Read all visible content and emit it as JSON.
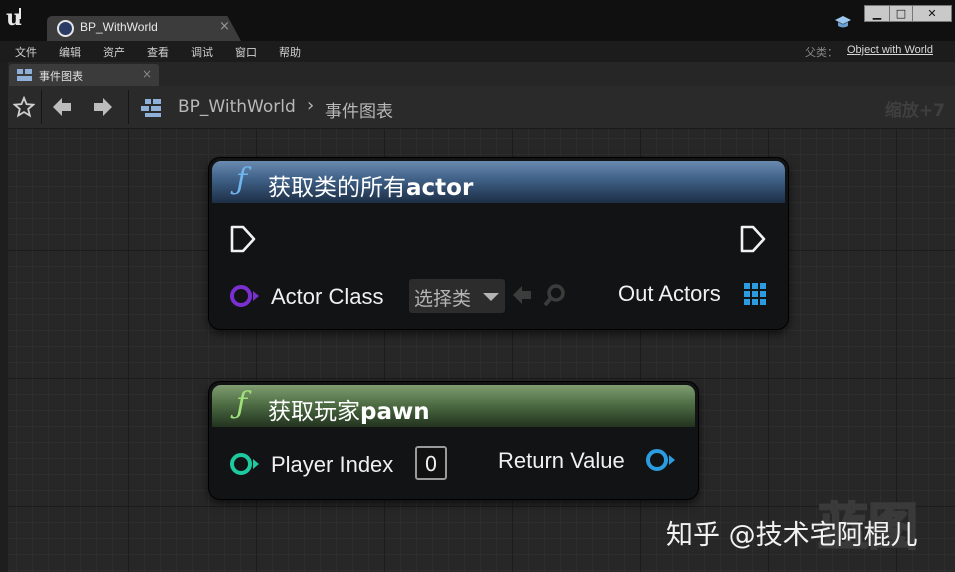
{
  "window": {
    "tab_title": "BP_WithWorld",
    "tab_close": "×",
    "buttons": {
      "minimize": "▁",
      "maximize": "□",
      "close": "✕"
    }
  },
  "menu": {
    "items": [
      "文件",
      "编辑",
      "资产",
      "查看",
      "调试",
      "窗口",
      "帮助"
    ],
    "parent_class_label": "父类：",
    "parent_class_value": "Object with World"
  },
  "panel": {
    "tab_label": "事件图表",
    "tab_close": "×"
  },
  "toolbar": {
    "breadcrumb_root": "BP_WithWorld",
    "breadcrumb_separator": "›",
    "breadcrumb_current": "事件图表",
    "zoom": "缩放+7"
  },
  "nodes": {
    "get_all_actors": {
      "title_cn": "获取类的所有",
      "title_en": "actor",
      "header_color": "#3e5f85",
      "input_label": "Actor Class",
      "input_pin_color": "#7a2fd0",
      "dropdown_value": "选择类",
      "output_label": "Out Actors",
      "output_pin_color": "#2b9ce0"
    },
    "get_player_pawn": {
      "title_cn": "获取玩家",
      "title_en": "pawn",
      "header_color": "#4f6e45",
      "input_label": "Player Index",
      "input_pin_color": "#1fc9a0",
      "index_value": "0",
      "output_label": "Return Value",
      "output_pin_color": "#2b9ce0"
    }
  },
  "watermark": {
    "text": "知乎 @技术宅阿棍儿",
    "logo_text": "蓝图"
  }
}
